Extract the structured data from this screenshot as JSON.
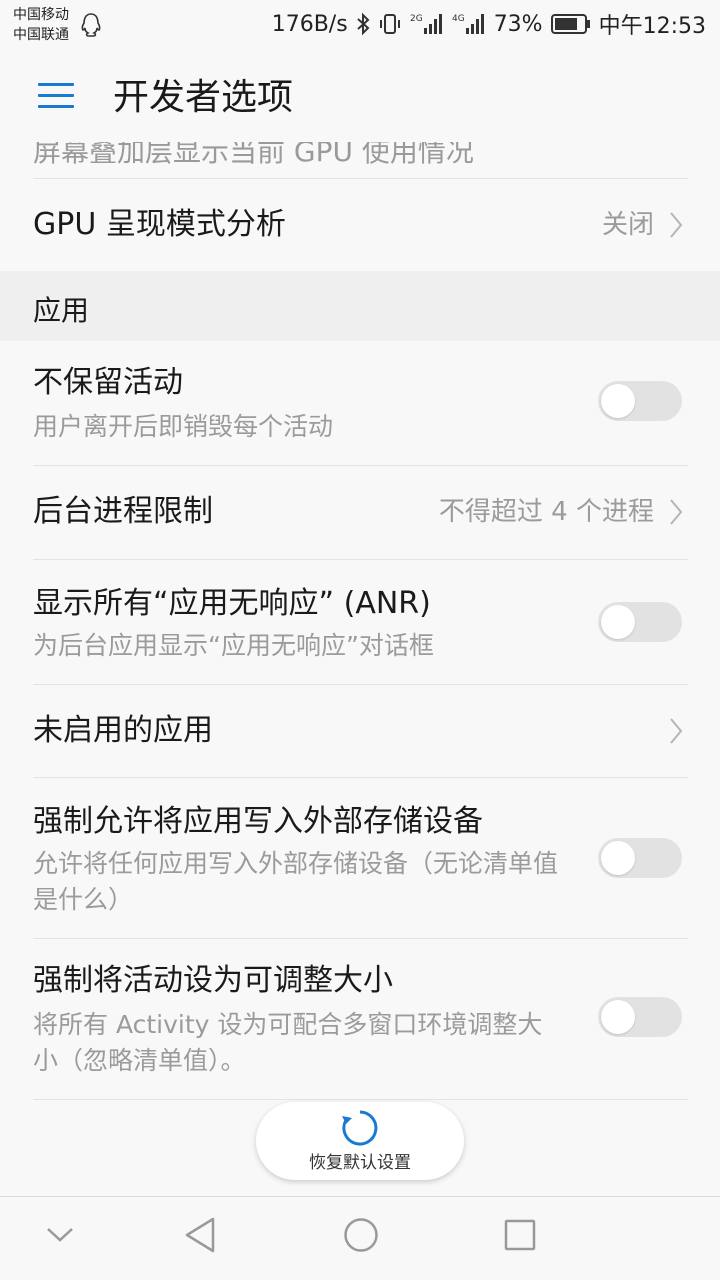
{
  "status_bar": {
    "carrier1": "中国移动",
    "carrier2": "中国联通",
    "net_speed": "176B/s",
    "battery_percent": "73%",
    "time": "中午12:53"
  },
  "app_bar": {
    "title": "开发者选项"
  },
  "partial_row": {
    "text": "屏幕叠加层显示当前 GPU 使用情况"
  },
  "gpu_row": {
    "title": "GPU 呈现模式分析",
    "value": "关闭"
  },
  "section": {
    "label": "应用"
  },
  "rows": {
    "dont_keep": {
      "title": "不保留活动",
      "subtitle": "用户离开后即销毁每个活动",
      "enabled": false
    },
    "bg_limit": {
      "title": "后台进程限制",
      "value": "不得超过 4 个进程"
    },
    "anr": {
      "title": "显示所有“应用无响应” (ANR)",
      "subtitle": "为后台应用显示“应用无响应”对话框",
      "enabled": false
    },
    "inactive_apps": {
      "title": "未启用的应用"
    },
    "force_external": {
      "title": "强制允许将应用写入外部存储设备",
      "subtitle": "允许将任何应用写入外部存储设备（无论清单值是什么）",
      "enabled": false
    },
    "force_resizable": {
      "title": "强制将活动设为可调整大小",
      "subtitle": "将所有 Activity 设为可配合多窗口环境调整大小（忽略清单值）。",
      "enabled": false
    }
  },
  "reset_button": {
    "label": "恢复默认设置"
  },
  "colors": {
    "accent": "#1a7ad1",
    "background": "#f8f8f8",
    "section_bg": "#efefef",
    "toggle_off": "#e2e2e2"
  },
  "icons": [
    "qq-icon",
    "bluetooth-icon",
    "vibrate-icon",
    "signal-2g-icon",
    "signal-4g-icon",
    "battery-icon",
    "menu-icon",
    "chevron-right-icon",
    "refresh-icon",
    "back-icon",
    "home-icon",
    "recents-icon",
    "hide-nav-icon"
  ]
}
